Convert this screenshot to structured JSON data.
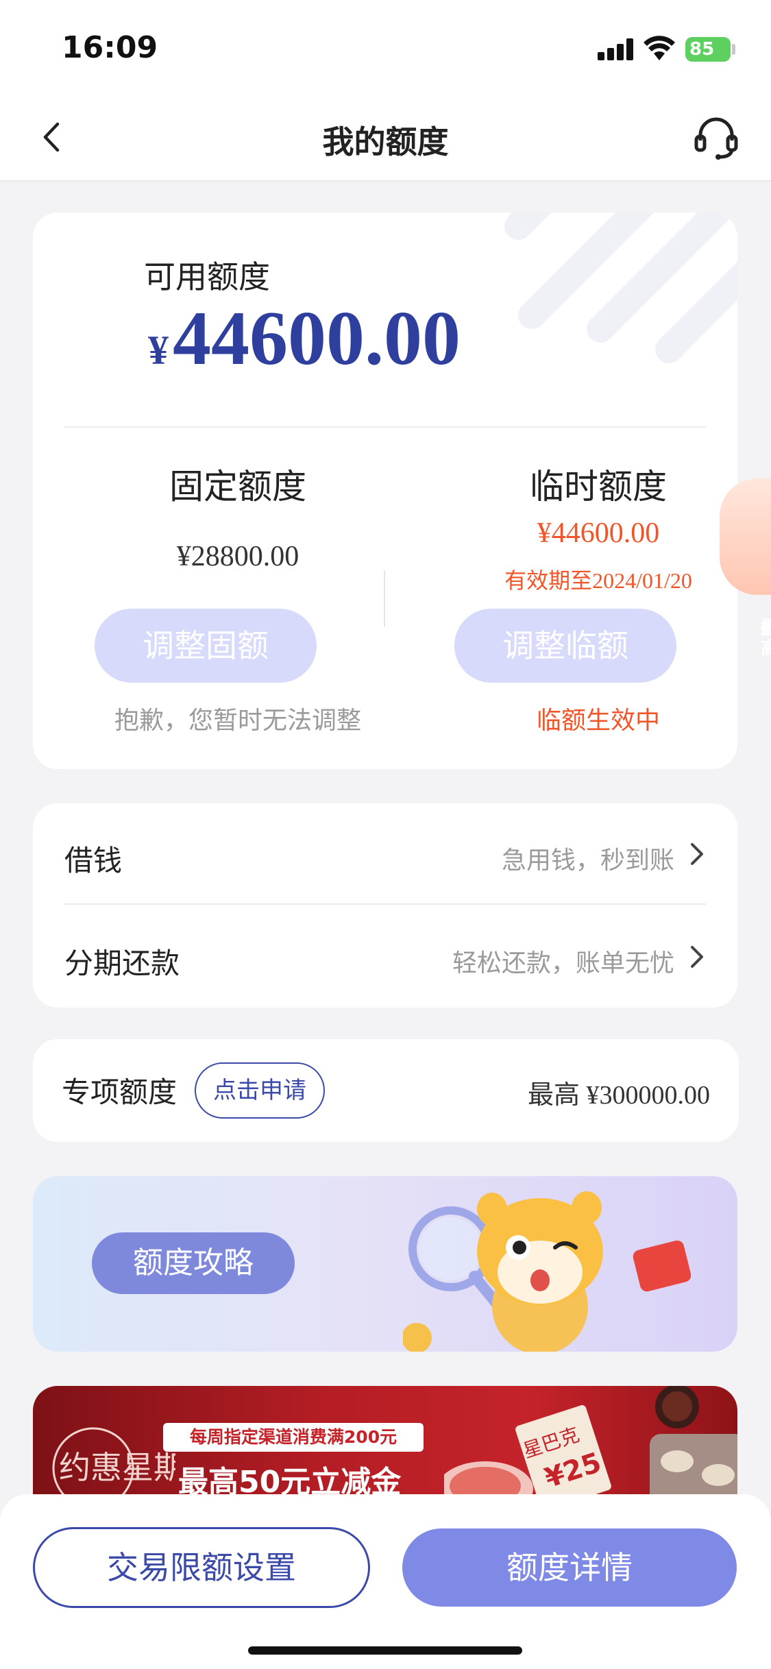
{
  "status_bar": {
    "time": "16:09",
    "battery": "85"
  },
  "nav": {
    "title": "我的额度"
  },
  "limit": {
    "available_label": "可用额度",
    "available_currency": "¥",
    "available_amount": "44600.00",
    "fixed": {
      "title": "固定额度",
      "amount": "¥28800.00",
      "button": "调整固额",
      "note": "抱歉，您暂时无法调整"
    },
    "temporary": {
      "title": "临时额度",
      "amount": "¥44600.00",
      "expire": "有效期至2024/01/20",
      "button": "调整临额",
      "note": "临额生效中"
    }
  },
  "float_badge": {
    "line1": "提",
    "line2": "最高"
  },
  "menu": [
    {
      "label": "借钱",
      "hint": "急用钱，秒到账"
    },
    {
      "label": "分期还款",
      "hint": "轻松还款，账单无忧"
    }
  ],
  "special": {
    "label": "专项额度",
    "apply": "点击申请",
    "max": "最高 ¥300000.00"
  },
  "strategy": {
    "button": "额度攻略"
  },
  "promo": {
    "logo_text": "约惠星期五",
    "strip": "每周指定渠道消费满200元",
    "headline": "最高50元立减金",
    "tag": "星巴克",
    "coupon": "¥25"
  },
  "bottom": {
    "tx_limit": "交易限额设置",
    "detail": "额度详情"
  },
  "colors": {
    "accent": "#2f3f9e",
    "warning": "#f0562a",
    "primary_button": "#7f89e6",
    "disabled_button": "#d7dafb"
  }
}
